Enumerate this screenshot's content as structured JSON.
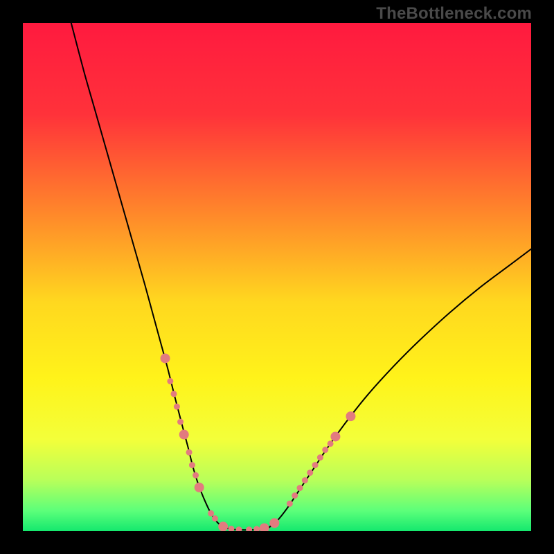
{
  "watermark": "TheBottleneck.com",
  "chart_data": {
    "type": "line",
    "title": "",
    "xlabel": "",
    "ylabel": "",
    "xlim": [
      0,
      100
    ],
    "ylim": [
      0,
      100
    ],
    "grid": false,
    "legend": false,
    "gradient_stops": [
      {
        "offset": 0.0,
        "color": "#ff1a3f"
      },
      {
        "offset": 0.18,
        "color": "#ff323a"
      },
      {
        "offset": 0.38,
        "color": "#ff8a2a"
      },
      {
        "offset": 0.55,
        "color": "#ffd81f"
      },
      {
        "offset": 0.7,
        "color": "#fff31a"
      },
      {
        "offset": 0.82,
        "color": "#f3ff3a"
      },
      {
        "offset": 0.9,
        "color": "#b8ff5a"
      },
      {
        "offset": 0.96,
        "color": "#5cff7a"
      },
      {
        "offset": 1.0,
        "color": "#14e86e"
      }
    ],
    "series": [
      {
        "name": "left-branch",
        "x": [
          9.5,
          12,
          14,
          16,
          18,
          20,
          22,
          24,
          25.5,
          27,
          28.5,
          30,
          31.3,
          32.5,
          33.5,
          34.6,
          35.8,
          37.0,
          38.2,
          39.4
        ],
        "y": [
          100,
          90.5,
          83.5,
          76.5,
          69.5,
          62.5,
          55.5,
          48.5,
          43,
          37.5,
          32,
          26,
          21,
          16.5,
          12.5,
          9,
          6,
          3.5,
          1.8,
          0.8
        ]
      },
      {
        "name": "floor",
        "x": [
          39.4,
          41,
          43,
          45,
          47,
          48.5
        ],
        "y": [
          0.8,
          0.4,
          0.25,
          0.25,
          0.4,
          0.8
        ]
      },
      {
        "name": "right-branch",
        "x": [
          48.5,
          50,
          52,
          54,
          57,
          60,
          64,
          68,
          73,
          78,
          84,
          90,
          96,
          100
        ],
        "y": [
          0.8,
          2.0,
          4.5,
          7.5,
          12,
          16.5,
          22,
          27,
          32.5,
          37.5,
          43,
          48,
          52.5,
          55.5
        ]
      }
    ],
    "marker_color": "#e27b7f",
    "marker_radius_large": 7,
    "marker_radius_small": 4.5,
    "markers": [
      {
        "branch": "left",
        "x": 28.0,
        "y": 34.0,
        "r": "large"
      },
      {
        "branch": "left",
        "x": 29.0,
        "y": 29.5,
        "r": "small"
      },
      {
        "branch": "left",
        "x": 29.7,
        "y": 27.0,
        "r": "small"
      },
      {
        "branch": "left",
        "x": 30.3,
        "y": 24.5,
        "r": "small"
      },
      {
        "branch": "left",
        "x": 31.0,
        "y": 21.5,
        "r": "small"
      },
      {
        "branch": "left",
        "x": 31.7,
        "y": 19.0,
        "r": "large"
      },
      {
        "branch": "left",
        "x": 32.7,
        "y": 15.5,
        "r": "small"
      },
      {
        "branch": "left",
        "x": 33.3,
        "y": 13.0,
        "r": "small"
      },
      {
        "branch": "left",
        "x": 34.0,
        "y": 11.0,
        "r": "small"
      },
      {
        "branch": "left",
        "x": 34.7,
        "y": 8.6,
        "r": "large"
      },
      {
        "branch": "floor",
        "x": 37.0,
        "y": 3.5,
        "r": "small"
      },
      {
        "branch": "floor",
        "x": 37.8,
        "y": 2.5,
        "r": "small"
      },
      {
        "branch": "floor",
        "x": 39.4,
        "y": 0.9,
        "r": "large"
      },
      {
        "branch": "floor",
        "x": 41.0,
        "y": 0.45,
        "r": "small"
      },
      {
        "branch": "floor",
        "x": 42.5,
        "y": 0.3,
        "r": "small"
      },
      {
        "branch": "floor",
        "x": 44.5,
        "y": 0.3,
        "r": "small"
      },
      {
        "branch": "floor",
        "x": 46.0,
        "y": 0.4,
        "r": "small"
      },
      {
        "branch": "floor",
        "x": 47.5,
        "y": 0.6,
        "r": "large"
      },
      {
        "branch": "right",
        "x": 49.5,
        "y": 1.6,
        "r": "large"
      },
      {
        "branch": "right",
        "x": 52.5,
        "y": 5.4,
        "r": "small"
      },
      {
        "branch": "right",
        "x": 53.5,
        "y": 7.0,
        "r": "small"
      },
      {
        "branch": "right",
        "x": 54.5,
        "y": 8.5,
        "r": "small"
      },
      {
        "branch": "right",
        "x": 55.5,
        "y": 10.0,
        "r": "small"
      },
      {
        "branch": "right",
        "x": 56.5,
        "y": 11.5,
        "r": "small"
      },
      {
        "branch": "right",
        "x": 57.5,
        "y": 13.0,
        "r": "small"
      },
      {
        "branch": "right",
        "x": 58.5,
        "y": 14.5,
        "r": "small"
      },
      {
        "branch": "right",
        "x": 59.5,
        "y": 16.0,
        "r": "small"
      },
      {
        "branch": "right",
        "x": 60.5,
        "y": 17.2,
        "r": "small"
      },
      {
        "branch": "right",
        "x": 61.5,
        "y": 18.6,
        "r": "large"
      },
      {
        "branch": "right",
        "x": 64.5,
        "y": 22.6,
        "r": "large"
      }
    ]
  }
}
